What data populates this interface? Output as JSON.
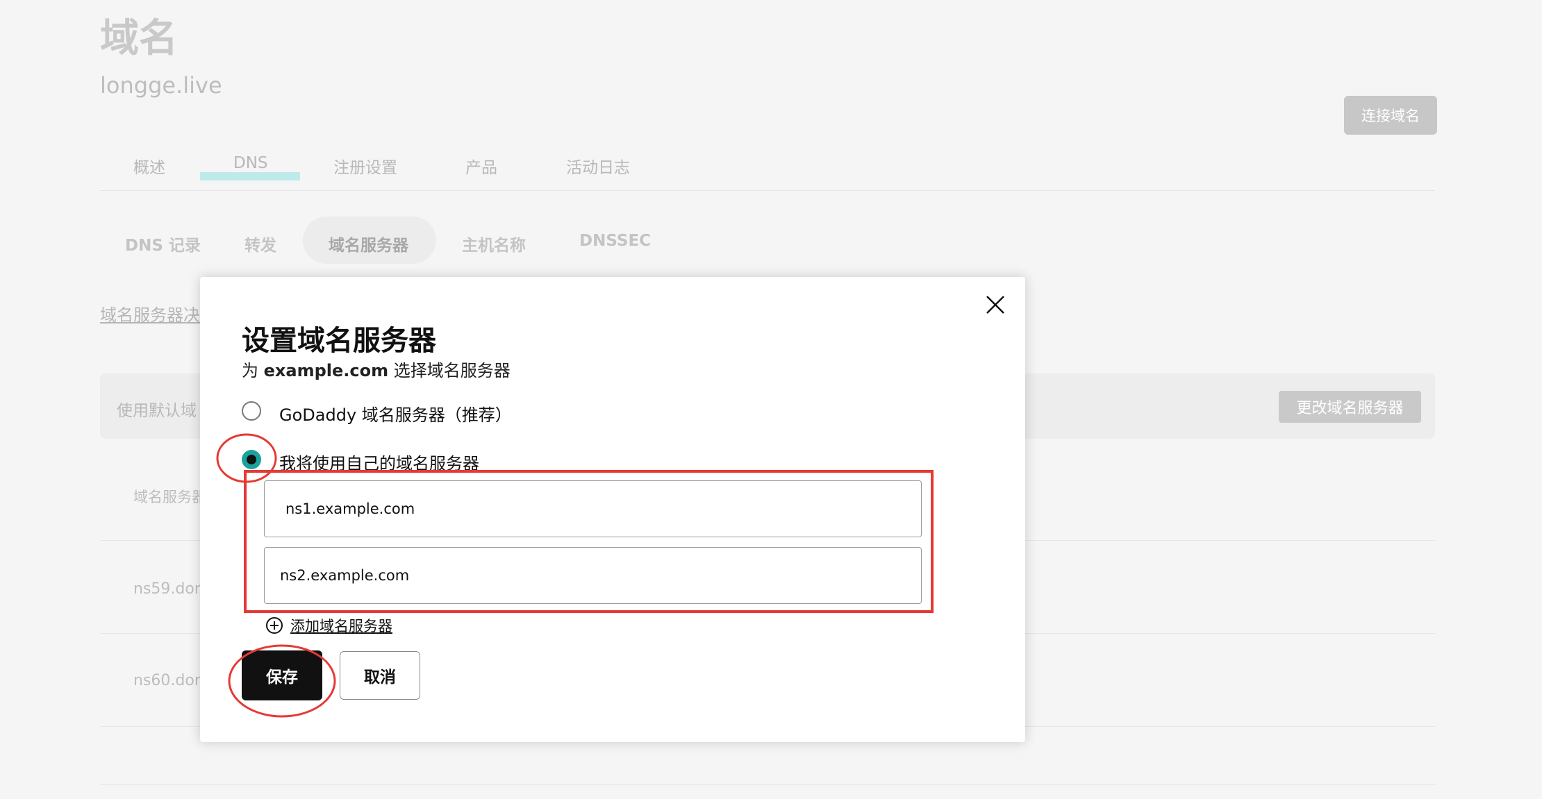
{
  "background": {
    "page_title": "域名",
    "domain": "longge.live",
    "connect_button": "连接域名",
    "tabs": [
      "概述",
      "DNS",
      "注册设置",
      "产品",
      "活动日志"
    ],
    "subtabs": [
      "DNS 记录",
      "转发",
      "域名服务器",
      "主机名称",
      "DNSSEC"
    ],
    "ns_link": "域名服务器决",
    "panel_text": "使用默认域",
    "change_button": "更改域名服务器",
    "rows": [
      "域名服务器",
      "ns59.don",
      "ns60.don"
    ]
  },
  "modal": {
    "title": "设置域名服务器",
    "subtitle_prefix": "为 ",
    "subtitle_domain": "example.com",
    "subtitle_suffix": " 选择域名服务器",
    "option_godaddy": "GoDaddy 域名服务器（推荐）",
    "option_custom": "我将使用自己的域名服务器",
    "ns1": "ns1.example.com",
    "ns2": "ns2.example.com",
    "add_label": "添加域名服务器",
    "save": "保存",
    "cancel": "取消"
  },
  "colors": {
    "accent": "#1aa39d",
    "annotation": "#e53935"
  }
}
